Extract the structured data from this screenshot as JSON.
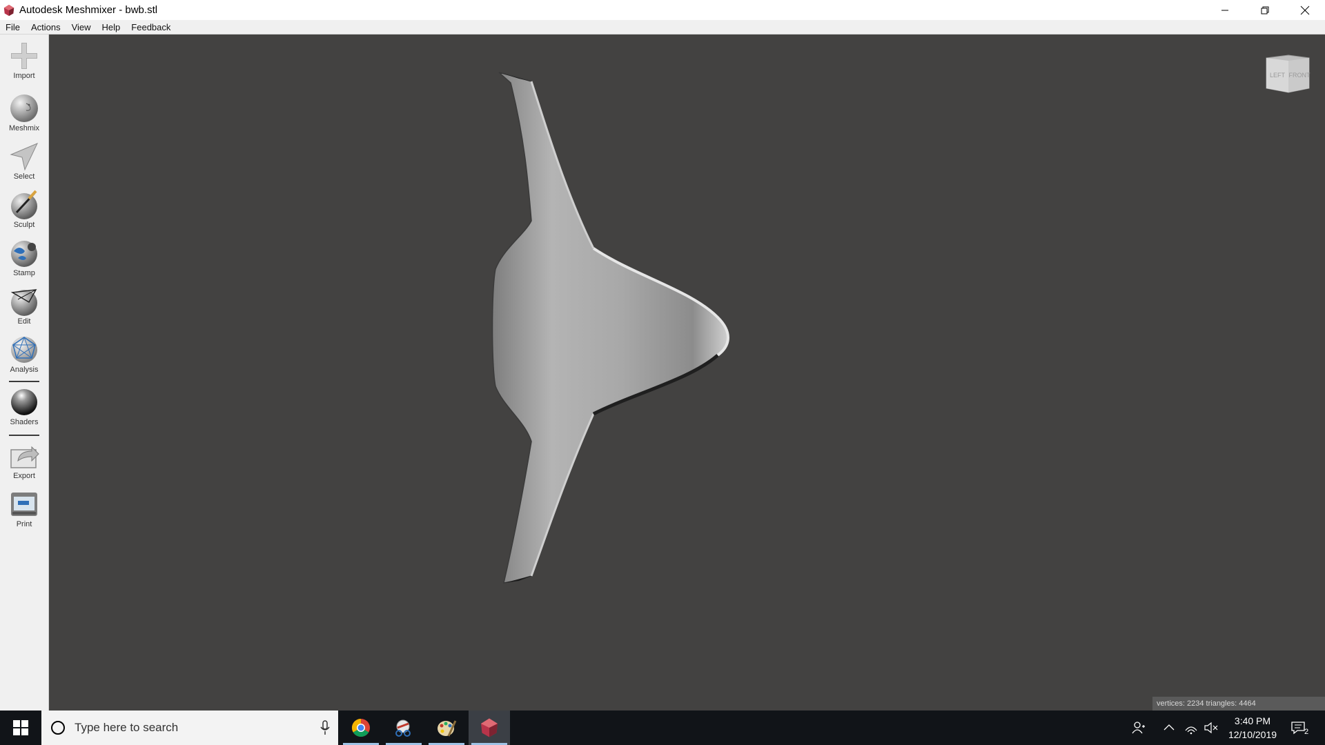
{
  "window": {
    "title": "Autodesk Meshmixer - bwb.stl"
  },
  "menu": [
    "File",
    "Actions",
    "View",
    "Help",
    "Feedback"
  ],
  "tools": [
    {
      "label": "Import",
      "icon": "plus-icon"
    },
    {
      "label": "Meshmix",
      "icon": "meshmix-icon"
    },
    {
      "label": "Select",
      "icon": "select-arrow-icon"
    },
    {
      "label": "Sculpt",
      "icon": "sculpt-brush-icon"
    },
    {
      "label": "Stamp",
      "icon": "stamp-icon"
    },
    {
      "label": "Edit",
      "icon": "edit-icon"
    },
    {
      "label": "Analysis",
      "icon": "analysis-icon"
    },
    {
      "label": "Shaders",
      "icon": "shaders-icon"
    },
    {
      "label": "Export",
      "icon": "export-icon"
    },
    {
      "label": "Print",
      "icon": "print-icon"
    }
  ],
  "viewcube": {
    "left": "LEFT",
    "front": "FRONT"
  },
  "stats": "vertices: 2234 triangles: 4464",
  "taskbar": {
    "search_placeholder": "Type here to search",
    "time": "3:40 PM",
    "date": "12/10/2019",
    "notifications": "2"
  },
  "colors": {
    "viewport": "#434241",
    "panel": "#f0f0f0",
    "taskbar": "#111418"
  }
}
